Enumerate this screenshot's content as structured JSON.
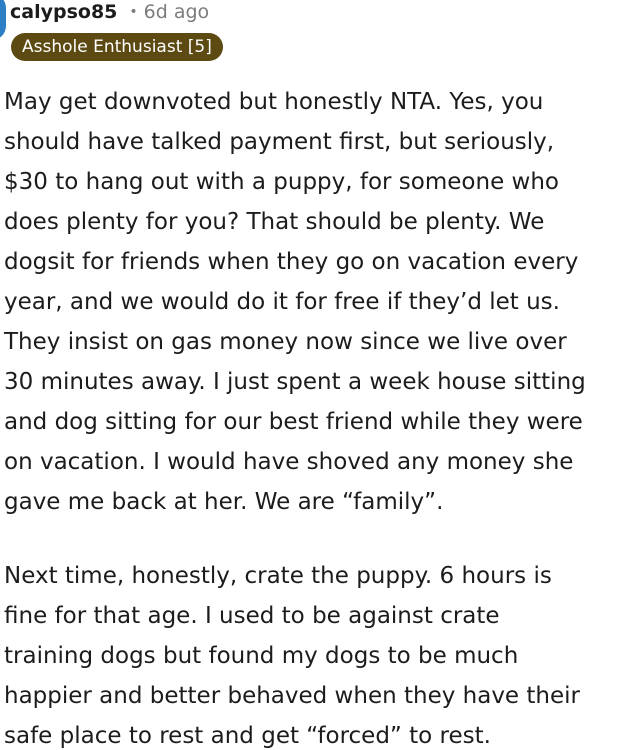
{
  "comment": {
    "author": "calypso85",
    "separator": "•",
    "age": "6d ago",
    "flair": "Asshole Enthusiast [5]",
    "paragraph_1": [
      "May get downvoted but honestly NTA. Yes, you",
      "should have talked payment first, but seriously,",
      "$30 to hang out with a puppy, for someone who",
      "does plenty for you? That should be plenty. We",
      "dogsit for friends when they go on vacation every",
      "year, and we would do it for free if they’d let us.",
      "They insist on gas money now since we live over",
      "30 minutes away. I just spent a week house sitting",
      "and dog sitting for our best friend while they were",
      "on vacation. I would have shoved any money she",
      "gave me back at her. We are “family”."
    ],
    "paragraph_2": [
      "Next time, honestly, crate the puppy. 6 hours is",
      "fine for that age. I used to be against crate",
      "training dogs but found my dogs to be much",
      "happier and better behaved when they have their",
      "safe place to rest and get “forced” to rest."
    ]
  },
  "colors": {
    "flair_background": "#5c4a12",
    "flair_text": "#ffffff",
    "avatar": "#2d7fc5",
    "meta_text": "#7c7c7c",
    "body_text": "#1c1c1c"
  }
}
